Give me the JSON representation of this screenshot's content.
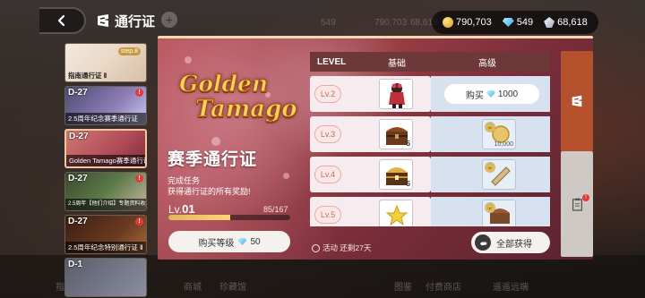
{
  "header": {
    "title": "通行证",
    "back_icon": "chevron-left-icon",
    "title_icon": "pass-ticket-icon"
  },
  "currencies": [
    {
      "name": "gold-coin",
      "value": "790,703"
    },
    {
      "name": "gem",
      "value": "549"
    },
    {
      "name": "crystal",
      "value": "68,618"
    }
  ],
  "background": {
    "ghost_currencies": [
      "549",
      "790,703",
      "68,618"
    ],
    "bottom_nav": [
      "指挥所",
      "伙伴",
      "背包",
      "商城",
      "珍藏馆",
      "图鉴",
      "付费商店",
      "遥遥远端"
    ]
  },
  "seasons": [
    {
      "tag": "",
      "label": "指南通行证 Ⅱ",
      "badge": "step.8"
    },
    {
      "tag": "D-27",
      "label": "2.5周年纪念赛季通行证"
    },
    {
      "tag": "D-27",
      "label": "Golden Tamago赛季通行证"
    },
    {
      "tag": "D-27",
      "label": "2.5周年【他们介绍】专题资料收藏通行证"
    },
    {
      "tag": "D-27",
      "label": "2.5周年纪念特别通行证 Ⅱ"
    },
    {
      "tag": "D-1",
      "label": ""
    }
  ],
  "panel": {
    "logo_line1": "Golden",
    "logo_line2": "Tamago",
    "season_title": "赛季通行证",
    "task_line1": "完成任务",
    "task_line2": "获得通行证的所有奖励!",
    "level_prefix": "Lv.",
    "level": "01",
    "xp_text": "85/167",
    "xp_progress": 0.51,
    "buy_level_label": "购买等级",
    "buy_level_cost": "50",
    "timer_text": "活动 还剩27天",
    "claim_all_label": "全部获得"
  },
  "reward_table": {
    "headers": {
      "level": "LEVEL",
      "free": "基础",
      "premium": "高级"
    },
    "buy_premium_label": "购买",
    "buy_premium_cost": "1000",
    "rows": [
      {
        "level": "Lv.2",
        "free_item": "doll-icon",
        "free_qty": "",
        "premium_item": "",
        "premium_qty": ""
      },
      {
        "level": "Lv.3",
        "free_item": "treasure-chest-icon",
        "free_qty": "5",
        "premium_item": "coin-icon",
        "premium_qty": "10,000"
      },
      {
        "level": "Lv.4",
        "free_item": "gold-chest-icon",
        "free_qty": "5",
        "premium_item": "scroll-icon",
        "premium_qty": ""
      },
      {
        "level": "Lv.5",
        "free_item": "star-crystal-icon",
        "free_qty": "",
        "premium_item": "chest-icon",
        "premium_qty": ""
      }
    ]
  },
  "colors": {
    "accent": "#b5512c",
    "panel_pink": "#9a3e44",
    "table_header": "#6e3838",
    "notify_red": "#e03a3a"
  }
}
